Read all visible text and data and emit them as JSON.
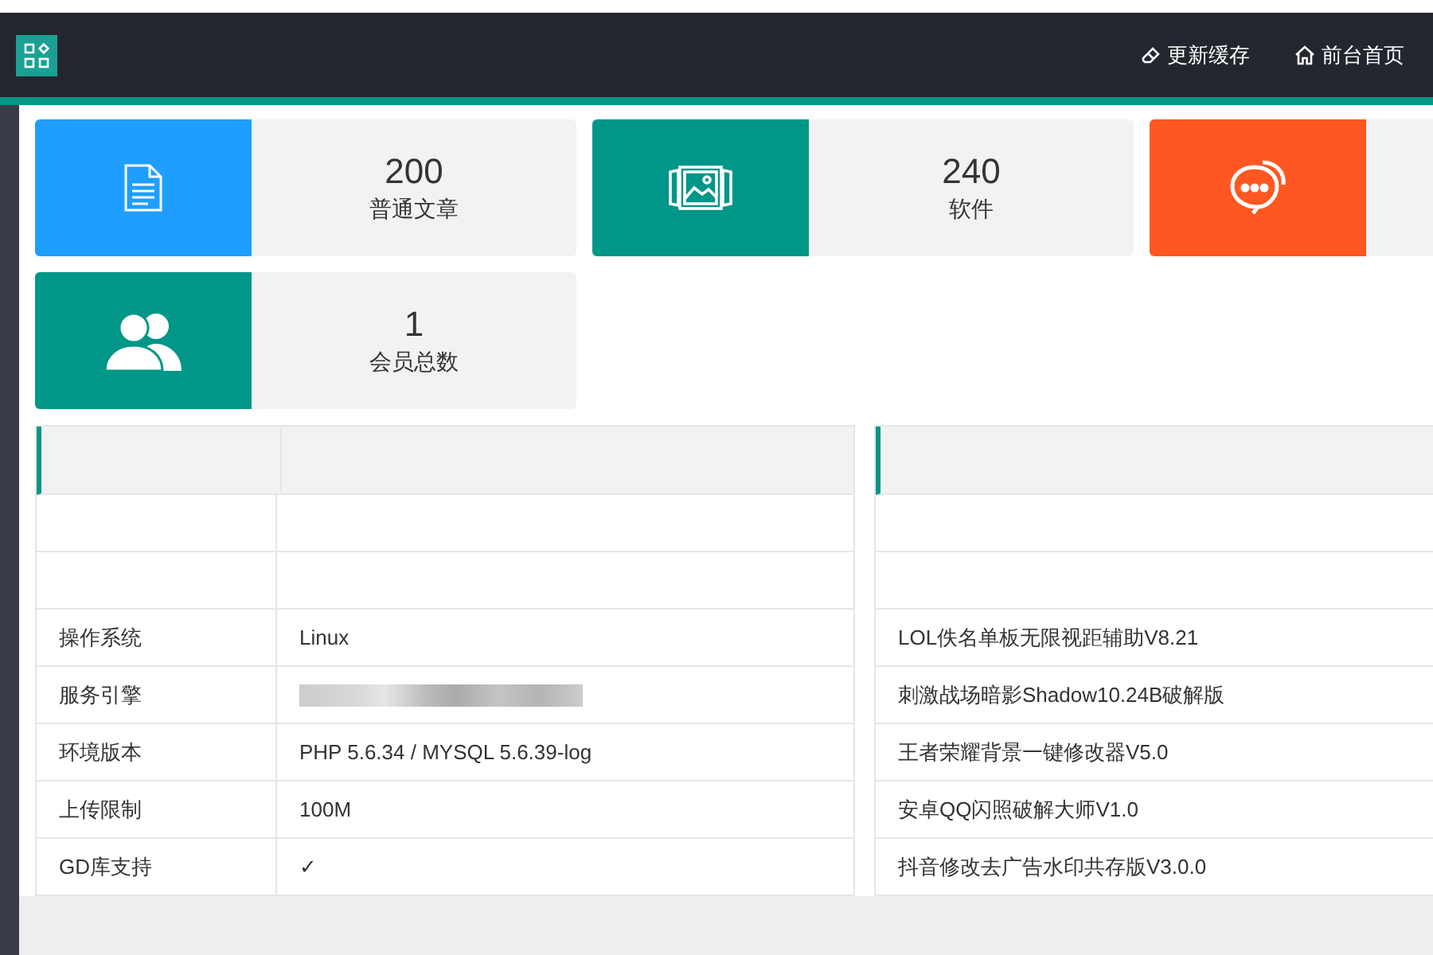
{
  "header": {
    "actions": [
      {
        "kind": "eraser",
        "label": "更新缓存"
      },
      {
        "kind": "home",
        "label": "前台首页"
      }
    ]
  },
  "stats": [
    {
      "kind": "document",
      "color": "#1e9fff",
      "value": "200",
      "label": "普通文章"
    },
    {
      "kind": "image",
      "color": "#009688",
      "value": "240",
      "label": "软件"
    },
    {
      "kind": "chat",
      "color": "#ff5722"
    },
    {
      "kind": "users",
      "color": "#009688",
      "value": "1",
      "label": "会员总数"
    }
  ],
  "system_table": {
    "rows": [
      {
        "label": "操作系统",
        "value": "Linux",
        "redacted": false
      },
      {
        "label": "服务引擎",
        "redacted": true
      },
      {
        "label": "环境版本",
        "value": "PHP 5.6.34 / MYSQL 5.6.39-log",
        "redacted": false
      },
      {
        "label": "上传限制",
        "value": "100M",
        "redacted": false
      },
      {
        "label": "GD库支持",
        "value": "✓",
        "redacted": false
      }
    ]
  },
  "software_list": {
    "items": [
      "LOL佚名单板无限视距辅助V8.21",
      "刺激战场暗影Shadow10.24B破解版",
      "王者荣耀背景一键修改器V5.0",
      "安卓QQ闪照破解大师V1.0",
      "抖音修改去广告水印共存版V3.0.0"
    ]
  }
}
